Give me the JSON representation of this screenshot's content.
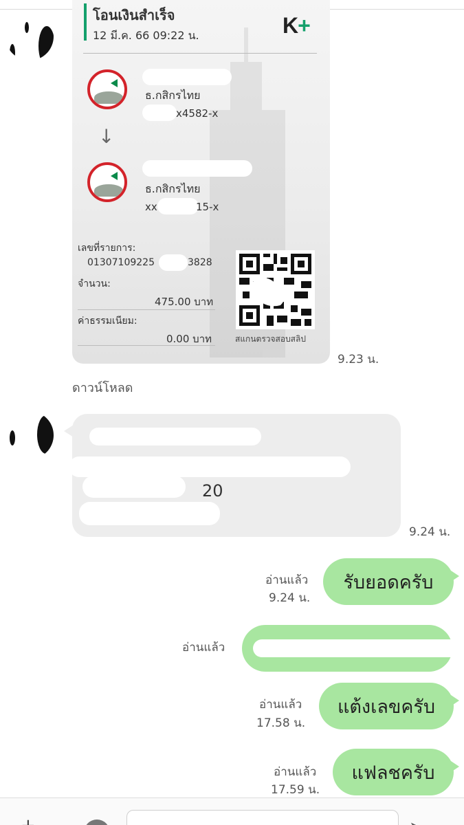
{
  "slip": {
    "title": "โอนเงินสำเร็จ",
    "datetime": "12 มี.ค. 66  09:22 น.",
    "brand": "K",
    "brand_plus": "+",
    "from_bank": "ธ.กสิกรไทย",
    "from_account": "x4582-x",
    "to_bank": "ธ.กสิกรไทย",
    "to_account_start": "xx",
    "to_account_end": "15-x",
    "ref_label": "เลขที่รายการ:",
    "ref_value_start": "01307109225",
    "ref_value_end": "3828",
    "amount_label": "จำนวน:",
    "amount_value": "475.00 บาท",
    "fee_label": "ค่าธรรมเนียม:",
    "fee_value": "0.00 บาท",
    "qr_caption": "สแกนตรวจสอบสลิป"
  },
  "slip_time": "9.23 น.",
  "download_label": "ดาวน์โหลด",
  "incoming_text": {
    "visible_fragment": "20",
    "time": "9.24 น."
  },
  "outgoing": [
    {
      "read": "อ่านแล้ว",
      "time": "9.24 น.",
      "text": "รับยอดครับ"
    },
    {
      "read": "อ่านแล้ว",
      "time": "",
      "text": ""
    },
    {
      "read": "อ่านแล้ว",
      "time": "17.58 น.",
      "text": "แต้งเลขครับ"
    },
    {
      "read": "อ่านแล้ว",
      "time": "17.59 น.",
      "text": "แฟลชครับ"
    }
  ],
  "icons": [
    "plus-icon",
    "sticker-icon",
    "send-icon"
  ],
  "colors": {
    "outgoing_bubble": "#a8e6a0",
    "incoming_bubble": "#ededed",
    "kbank_green": "#14a06b",
    "kbank_red": "#d3232a"
  }
}
